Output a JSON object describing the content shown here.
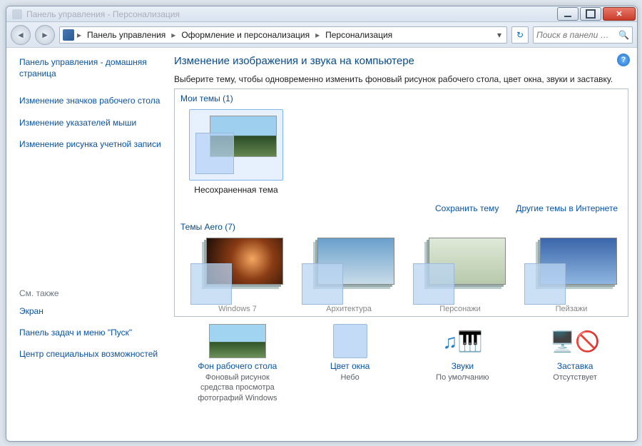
{
  "titlebar": {
    "title": "Панель управления - Персонализация"
  },
  "nav": {
    "breadcrumbs": [
      "Панель управления",
      "Оформление и персонализация",
      "Персонализация"
    ],
    "search_placeholder": "Поиск в панели …"
  },
  "sidebar": {
    "home": "Панель управления - домашняя страница",
    "links": [
      "Изменение значков рабочего стола",
      "Изменение указателей мыши",
      "Изменение рисунка учетной записи"
    ],
    "see_also_title": "См. также",
    "see_also": [
      "Экран",
      "Панель задач и меню \"Пуск\"",
      "Центр специальных возможностей"
    ]
  },
  "main": {
    "heading": "Изменение изображения и звука на компьютере",
    "description": "Выберите тему, чтобы одновременно изменить фоновый рисунок рабочего стола, цвет окна, звуки и заставку.",
    "my_themes_title": "Мои темы (1)",
    "my_themes": [
      {
        "label": "Несохраненная тема"
      }
    ],
    "save_theme": "Сохранить тему",
    "more_themes": "Другие темы в Интернете",
    "aero_title": "Темы Aero (7)",
    "aero": [
      {
        "label": "Windows 7"
      },
      {
        "label": "Архитектура"
      },
      {
        "label": "Персонажи"
      },
      {
        "label": "Пейзажи"
      }
    ],
    "bottom": [
      {
        "title": "Фон рабочего стола",
        "sub": "Фоновый рисунок средства просмотра фотографий Windows"
      },
      {
        "title": "Цвет окна",
        "sub": "Небо"
      },
      {
        "title": "Звуки",
        "sub": "По умолчанию"
      },
      {
        "title": "Заставка",
        "sub": "Отсутствует"
      }
    ]
  }
}
